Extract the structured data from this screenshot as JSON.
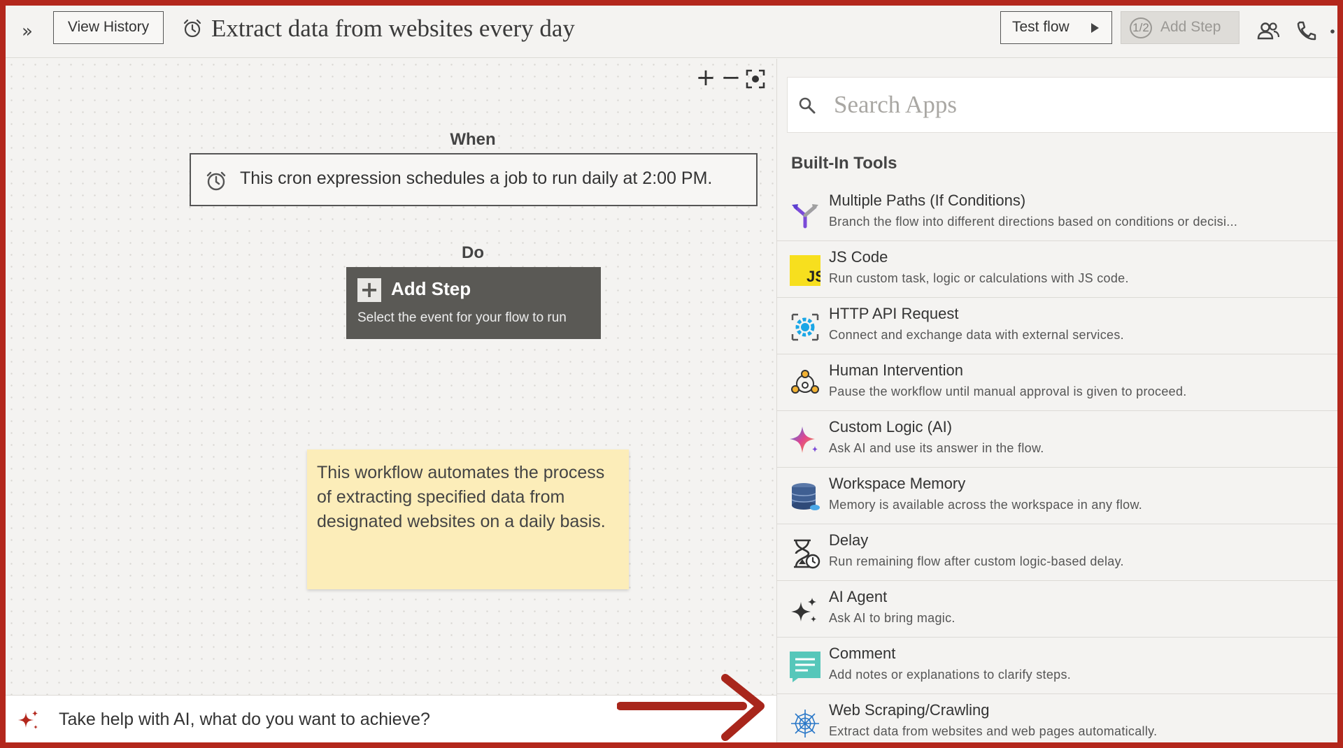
{
  "header": {
    "view_history_label": "View History",
    "flow_title": "Extract data from websites every day",
    "test_flow_label": "Test flow",
    "add_step_badge": "1/2",
    "add_step_label": "Add Step"
  },
  "canvas": {
    "when_label": "When",
    "trigger_text": "This cron expression schedules a job to run daily at 2:00 PM.",
    "do_label": "Do",
    "add_step_title": "Add Step",
    "add_step_subtitle": "Select the event for your flow to run",
    "note_text": "This workflow automates the process of extracting specified data from designated websites on a daily basis."
  },
  "ai_bar": {
    "prompt": "Take help with AI, what do you want to achieve?"
  },
  "panel": {
    "search_placeholder": "Search Apps",
    "section_title": "Built-In Tools",
    "tools": [
      {
        "name": "Multiple Paths (If Conditions)",
        "desc": "Branch the flow into different directions based on conditions or decisi...",
        "icon": "branch-icon"
      },
      {
        "name": "JS Code",
        "desc": "Run custom task, logic or calculations with JS code.",
        "icon": "js-icon"
      },
      {
        "name": "HTTP API Request",
        "desc": "Connect and exchange data with external services.",
        "icon": "api-gear-icon"
      },
      {
        "name": "Human Intervention",
        "desc": "Pause the workflow until manual approval is given to proceed.",
        "icon": "people-network-icon"
      },
      {
        "name": "Custom Logic (AI)",
        "desc": "Ask AI and use its answer in the flow.",
        "icon": "ai-star-icon"
      },
      {
        "name": "Workspace Memory",
        "desc": "Memory is available across the workspace in any flow.",
        "icon": "database-icon"
      },
      {
        "name": "Delay",
        "desc": "Run remaining flow after custom logic-based delay.",
        "icon": "hourglass-icon"
      },
      {
        "name": "AI Agent",
        "desc": "Ask AI to bring magic.",
        "icon": "sparkles-icon"
      },
      {
        "name": "Comment",
        "desc": "Add notes or explanations to clarify steps.",
        "icon": "comment-icon"
      },
      {
        "name": "Web Scraping/Crawling",
        "desc": "Extract data from websites and web pages automatically.",
        "icon": "spider-web-icon"
      }
    ]
  },
  "colors": {
    "frame": "#b3271c",
    "arrow": "#a8261b",
    "add_step_card": "#5a5955",
    "note": "#fcedb9"
  }
}
